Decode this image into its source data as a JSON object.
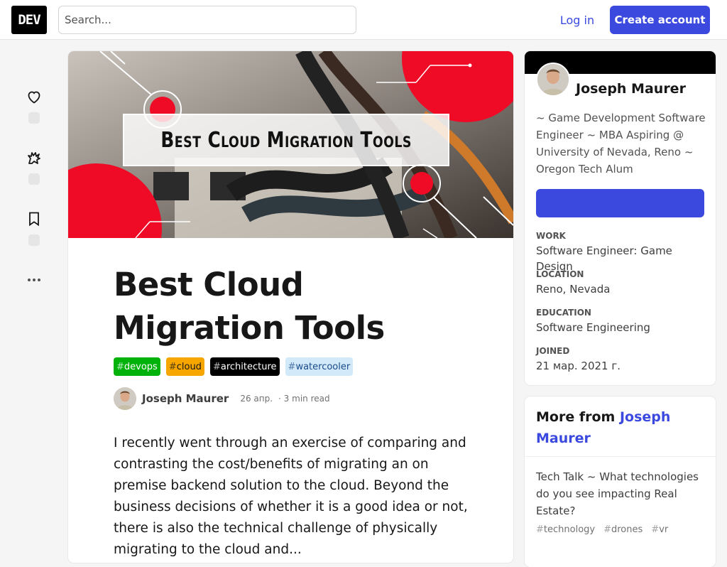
{
  "header": {
    "logo": "DEV",
    "search_placeholder": "Search...",
    "login_label": "Log in",
    "create_account_label": "Create account"
  },
  "reactions": {
    "items": [
      {
        "icon": "heart-icon"
      },
      {
        "icon": "unicorn-icon"
      },
      {
        "icon": "bookmark-icon"
      },
      {
        "icon": "more-icon"
      }
    ]
  },
  "article": {
    "cover_text": "Best Cloud Migration Tools",
    "title": "Best Cloud Migration Tools",
    "tags": [
      {
        "hash": "#",
        "name": "devops",
        "bg": "#00b20a",
        "fg": "#ffffff"
      },
      {
        "hash": "#",
        "name": "cloud",
        "bg": "#f7a600",
        "fg": "#171717"
      },
      {
        "hash": "#",
        "name": "architecture",
        "bg": "#000000",
        "fg": "#ffffff"
      },
      {
        "hash": "#",
        "name": "watercooler",
        "bg": "#d2e9fa",
        "fg": "#1a4a8a"
      }
    ],
    "author": "Joseph Maurer",
    "date": "26 апр.",
    "read_time": "· 3 min read",
    "body": "I recently went through an exercise of comparing and contrasting the cost/benefits of migrating an on premise backend solution to the cloud. Beyond the business decisions of whether it is a good idea or not, there is also the technical challenge of physically migrating to the cloud and..."
  },
  "profile": {
    "name": "Joseph Maurer",
    "bio": "~ Game Development Software Engineer ~ MBA Aspiring @ University of Nevada, Reno ~ Oregon Tech Alum",
    "details": [
      {
        "label": "WORK",
        "value": "Software Engineer: Game Design"
      },
      {
        "label": "LOCATION",
        "value": "Reno, Nevada"
      },
      {
        "label": "EDUCATION",
        "value": "Software Engineering"
      },
      {
        "label": "JOINED",
        "value": "21 мар. 2021 г."
      }
    ]
  },
  "more_from": {
    "prefix": "More from",
    "author": "Joseph Maurer",
    "item_title": "Tech Talk ~ What technologies do you see impacting Real Estate?",
    "item_tags": [
      "technology",
      "drones",
      "vr"
    ]
  },
  "colors": {
    "accent": "#3b49df",
    "cover_red": "#ef0a26"
  }
}
